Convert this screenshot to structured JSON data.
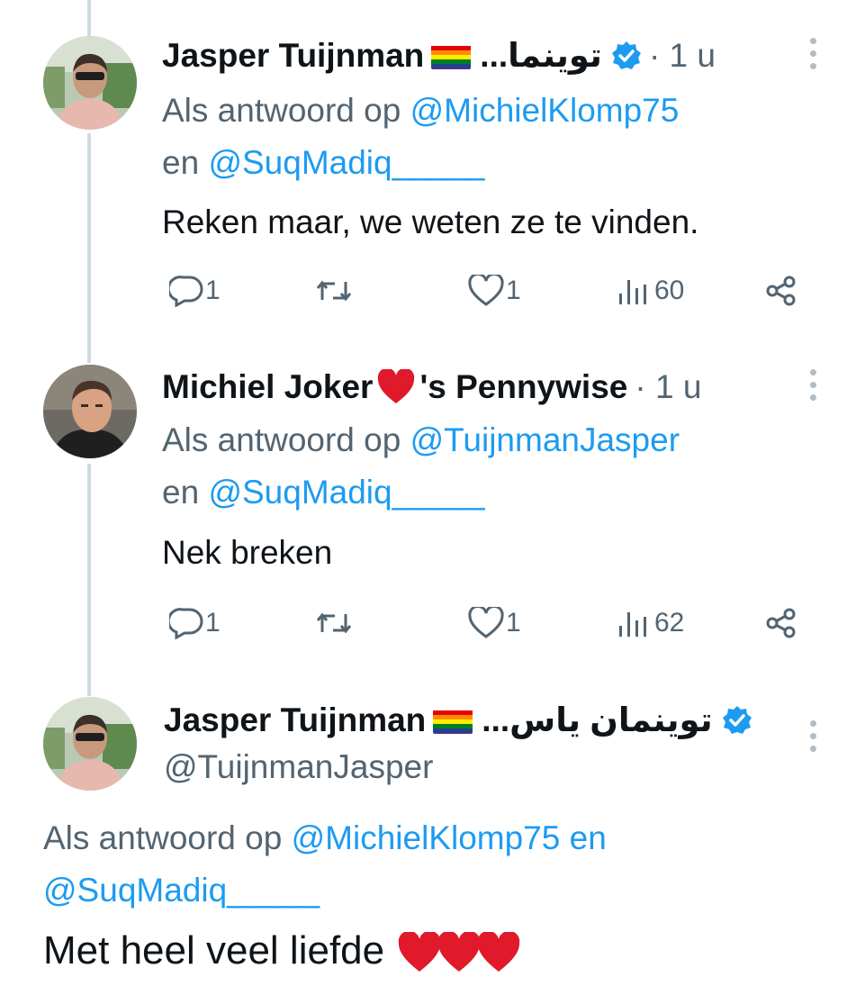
{
  "tweets": [
    {
      "name": "Jasper Tuijnman",
      "arabic": "توينما",
      "ellipsis": "...",
      "time": "· 1 u",
      "reply_prefix": "Als antwoord op",
      "mention1": "@MichielKlomp75",
      "conj": "en",
      "mention2": "@SuqMadiq_____",
      "text": "Reken maar, we weten ze te vinden.",
      "replies": "1",
      "likes": "1",
      "views": "60"
    },
    {
      "name_part1": "Michiel Joker",
      "name_part2": "'s Pennywise",
      "time": "· 1 u",
      "reply_prefix": "Als antwoord op",
      "mention1": "@TuijnmanJasper",
      "conj": "en",
      "mention2": "@SuqMadiq_____",
      "text": "Nek breken",
      "replies": "1",
      "likes": "1",
      "views": "62"
    },
    {
      "name": "Jasper Tuijnman",
      "arabic": "توينمان ياس",
      "ellipsis": "...",
      "handle": "@TuijnmanJasper",
      "reply_prefix": "Als antwoord op",
      "mention1": "@MichielKlomp75",
      "conj": "en",
      "mention2": "@SuqMadiq_____",
      "text": "Met heel veel liefde"
    }
  ],
  "colors": {
    "text": "#0f1419",
    "secondary": "#536471",
    "link": "#1d9bf0",
    "verified": "#1d9bf0",
    "heart": "#e0192b"
  }
}
